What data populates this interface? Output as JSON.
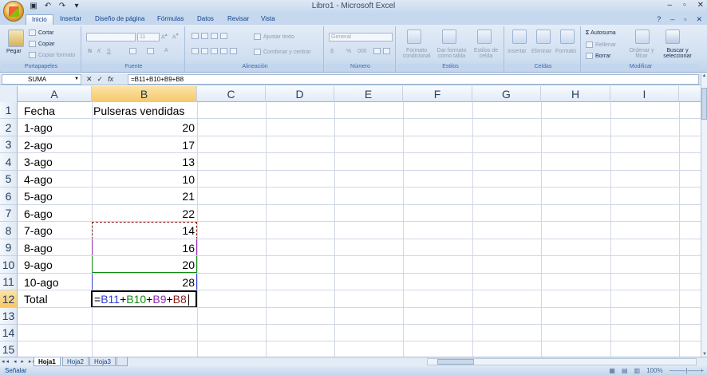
{
  "window": {
    "title": "Libro1 - Microsoft Excel"
  },
  "ribbon": {
    "tabs": [
      "Inicio",
      "Insertar",
      "Diseño de página",
      "Fórmulas",
      "Datos",
      "Revisar",
      "Vista"
    ],
    "clipboard": {
      "paste": "Pegar",
      "cut": "Cortar",
      "copy": "Copiar",
      "format_painter": "Copiar formato",
      "label": "Portapapeles"
    },
    "font": {
      "font_name": "",
      "font_size": "11",
      "bold": "N",
      "italic": "K",
      "underline": "S",
      "label": "Fuente"
    },
    "alignment": {
      "wrap": "Ajustar texto",
      "merge": "Combinar y centrar",
      "label": "Alineación"
    },
    "number": {
      "format": "General",
      "currency": "$",
      "percent": "%",
      "thousands": "000",
      "label": "Número"
    },
    "styles": {
      "conditional": "Formato condicional",
      "as_table": "Dar formato como tabla",
      "cell_styles": "Estilos de celda",
      "label": "Estilos"
    },
    "cells": {
      "insert": "Insertar",
      "delete": "Eliminar",
      "format": "Formato",
      "label": "Celdas"
    },
    "editing": {
      "autosum": "Autosuma",
      "fill": "Rellenar",
      "clear": "Borrar",
      "sort": "Ordenar y filtrar",
      "find": "Buscar y seleccionar",
      "label": "Modificar"
    }
  },
  "formula_bar": {
    "name_box": "SUMA",
    "fx": "fx",
    "formula": "=B11+B10+B9+B8"
  },
  "grid": {
    "columns": [
      "A",
      "B",
      "C",
      "D",
      "E",
      "F",
      "G",
      "H",
      "I"
    ],
    "rows": [
      "1",
      "2",
      "3",
      "4",
      "5",
      "6",
      "7",
      "8",
      "9",
      "10",
      "11",
      "12",
      "13",
      "14",
      "15"
    ],
    "cells_a": [
      "Fecha",
      "1-ago",
      "2-ago",
      "3-ago",
      "4-ago",
      "5-ago",
      "6-ago",
      "7-ago",
      "8-ago",
      "9-ago",
      "10-ago",
      "Total"
    ],
    "cells_b": [
      "Pulseras vendidas",
      "20",
      "17",
      "13",
      "10",
      "21",
      "22",
      "14",
      "16",
      "20",
      "28"
    ],
    "editing_formula": {
      "eq": "=",
      "r1": "B11",
      "p1": "+",
      "r2": "B10",
      "p2": "+",
      "r3": "B9",
      "p3": "+",
      "r4": "B8"
    },
    "ref_colors": {
      "B11": "#2f3fd8",
      "B10": "#128a12",
      "B9": "#8b2fb5",
      "B8": "#8b1e1e"
    }
  },
  "sheets": [
    "Hoja1",
    "Hoja2",
    "Hoja3"
  ],
  "status": {
    "mode": "Señalar",
    "zoom": "100%"
  }
}
